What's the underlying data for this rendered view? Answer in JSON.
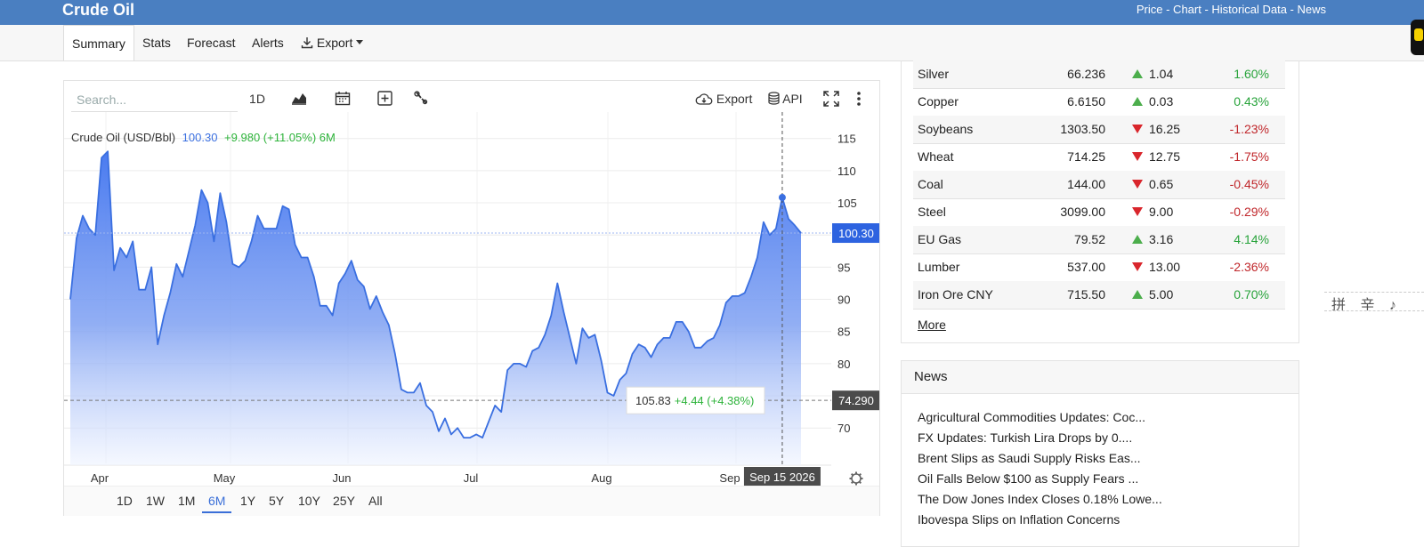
{
  "header": {
    "title": "Crude Oil",
    "links": "Price - Chart - Historical Data - News"
  },
  "nav": {
    "tabs": [
      "Summary",
      "Stats",
      "Forecast",
      "Alerts",
      "Export"
    ],
    "active": "Summary"
  },
  "toolbar": {
    "search_placeholder": "Search...",
    "interval": "1D",
    "export_label": "Export",
    "api_label": "API",
    "icons": [
      "chart-type-icon",
      "calendar-icon",
      "add-indicator-icon",
      "wrench-icon",
      "cloud-download-icon",
      "database-icon",
      "fullscreen-icon",
      "more-vert-icon",
      "settings-gear-icon"
    ]
  },
  "chart_info": {
    "name": "Crude Oil (USD/Bbl)",
    "price": "100.30",
    "change": "+9.980 (+11.05%) 6M"
  },
  "chart_data": {
    "type": "area",
    "x_labels": [
      "Apr",
      "May",
      "Jun",
      "Jul",
      "Aug",
      "Sep"
    ],
    "y_ticks": [
      70,
      75,
      80,
      85,
      90,
      95,
      100,
      105,
      110,
      115
    ],
    "ylim": [
      64.5,
      118
    ],
    "last_price_label": "100.30",
    "crosshair_price_label": "74.290",
    "crosshair_date_label": "Sep 15 2026",
    "tooltip": {
      "value": "105.83",
      "change": "+4.44 (+4.38%)"
    },
    "grid": true,
    "colors": {
      "line": "#3a6fe0",
      "area_top": "#4a7bf0",
      "area_bottom": "#eef3ff"
    },
    "values": [
      90.0,
      99.5,
      103.0,
      101.0,
      100.0,
      112.0,
      113.0,
      94.5,
      98.0,
      96.5,
      99.0,
      91.5,
      91.5,
      95.0,
      83.0,
      87.5,
      91.0,
      95.5,
      93.5,
      97.5,
      101.5,
      107.0,
      105.0,
      99.0,
      106.5,
      102.0,
      95.5,
      95.0,
      96.0,
      99.0,
      103.0,
      101.0,
      101.0,
      101.0,
      104.5,
      104.0,
      98.5,
      96.5,
      96.5,
      93.5,
      89.0,
      89.0,
      87.5,
      92.5,
      94.0,
      96.0,
      93.0,
      92.0,
      88.5,
      90.5,
      88.0,
      86.0,
      81.5,
      76.0,
      75.5,
      75.5,
      77.0,
      73.5,
      72.5,
      69.5,
      71.5,
      69.0,
      70.0,
      68.5,
      68.5,
      69.0,
      68.5,
      71.0,
      73.5,
      72.5,
      79.0,
      80.0,
      80.0,
      79.5,
      82.0,
      82.5,
      84.5,
      87.5,
      92.5,
      88.0,
      84.0,
      80.0,
      85.5,
      84.0,
      84.5,
      80.5,
      75.5,
      75.0,
      77.5,
      78.5,
      81.5,
      83.0,
      82.5,
      81.0,
      83.0,
      84.0,
      84.0,
      86.5,
      86.5,
      85.0,
      82.5,
      82.5,
      83.5,
      84.0,
      86.0,
      89.5,
      90.5,
      90.5,
      91.0,
      93.5,
      96.5,
      102.0,
      100.0,
      101.0,
      105.83,
      102.5,
      101.5,
      100.3
    ],
    "ranges": [
      "1D",
      "1W",
      "1M",
      "6M",
      "1Y",
      "5Y",
      "10Y",
      "25Y",
      "All"
    ],
    "active_range": "6M"
  },
  "commodities": [
    {
      "name": "Silver",
      "price": "66.236",
      "dir": "up",
      "change": "1.04",
      "pct": "1.60%"
    },
    {
      "name": "Copper",
      "price": "6.6150",
      "dir": "up",
      "change": "0.03",
      "pct": "0.43%"
    },
    {
      "name": "Soybeans",
      "price": "1303.50",
      "dir": "down",
      "change": "16.25",
      "pct": "-1.23%"
    },
    {
      "name": "Wheat",
      "price": "714.25",
      "dir": "down",
      "change": "12.75",
      "pct": "-1.75%"
    },
    {
      "name": "Coal",
      "price": "144.00",
      "dir": "down",
      "change": "0.65",
      "pct": "-0.45%"
    },
    {
      "name": "Steel",
      "price": "3099.00",
      "dir": "down",
      "change": "9.00",
      "pct": "-0.29%"
    },
    {
      "name": "EU Gas",
      "price": "79.52",
      "dir": "up",
      "change": "3.16",
      "pct": "4.14%"
    },
    {
      "name": "Lumber",
      "price": "537.00",
      "dir": "down",
      "change": "13.00",
      "pct": "-2.36%"
    },
    {
      "name": "Iron Ore CNY",
      "price": "715.50",
      "dir": "up",
      "change": "5.00",
      "pct": "0.70%"
    }
  ],
  "more_label": "More",
  "news": {
    "title": "News",
    "items": [
      "Agricultural Commodities Updates: Coc...",
      "FX Updates: Turkish Lira Drops by 0....",
      "Brent Slips as Saudi Supply Risks Eas...",
      "Oil Falls Below $100 as Supply Fears ...",
      "The Dow Jones Index Closes 0.18% Lowe...",
      "Ibovespa Slips on Inflation Concerns"
    ]
  },
  "ime_bar": "拼 辛 ♪"
}
